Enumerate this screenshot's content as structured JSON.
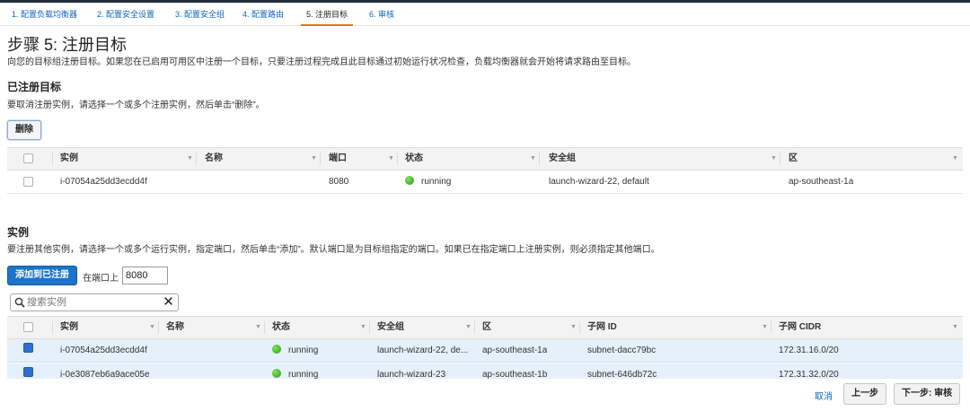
{
  "wizard": {
    "steps": [
      {
        "label": "1. 配置负载均衡器"
      },
      {
        "label": "2. 配置安全设置"
      },
      {
        "label": "3. 配置安全组"
      },
      {
        "label": "4. 配置路由"
      },
      {
        "label": "5. 注册目标",
        "active": true
      },
      {
        "label": "6. 审核"
      }
    ]
  },
  "page": {
    "title": "步骤 5: 注册目标",
    "description": "向您的目标组注册目标。如果您在已启用可用区中注册一个目标，只要注册过程完成且此目标通过初始运行状况检查，负载均衡器就会开始将请求路由至目标。"
  },
  "registered": {
    "title": "已注册目标",
    "description": "要取消注册实例，请选择一个或多个注册实例，然后单击“删除”。",
    "remove_button": "删除",
    "columns": [
      "实例",
      "名称",
      "端口",
      "状态",
      "安全组",
      "区"
    ],
    "rows": [
      {
        "instance": "i-07054a25dd3ecdd4f",
        "name": "",
        "port": "8080",
        "status": "running",
        "security_group": "launch-wizard-22, default",
        "zone": "ap-southeast-1a"
      }
    ]
  },
  "instances": {
    "title": "实例",
    "description": "要注册其他实例，请选择一个或多个运行实例，指定端口，然后单击“添加”。默认端口是为目标组指定的端口。如果已在指定端口上注册实例，则必须指定其他端口。",
    "add_button": "添加到已注册",
    "port_label": "在端口上",
    "port_value": "8080",
    "search_placeholder": "搜索实例",
    "columns": [
      "实例",
      "名称",
      "状态",
      "安全组",
      "区",
      "子网 ID",
      "子网 CIDR"
    ],
    "rows": [
      {
        "instance": "i-07054a25dd3ecdd4f",
        "name": "",
        "status": "running",
        "security_group": "launch-wizard-22, de...",
        "zone": "ap-southeast-1a",
        "subnet_id": "subnet-dacc79bc",
        "subnet_cidr": "172.31.16.0/20",
        "selected": true
      },
      {
        "instance": "i-0e3087eb6a9ace05e",
        "name": "",
        "status": "running",
        "security_group": "launch-wizard-23",
        "zone": "ap-southeast-1b",
        "subnet_id": "subnet-646db72c",
        "subnet_cidr": "172.31.32.0/20",
        "selected": true
      }
    ]
  },
  "footer": {
    "cancel": "取消",
    "previous": "上一步",
    "next": "下一步: 审核"
  }
}
